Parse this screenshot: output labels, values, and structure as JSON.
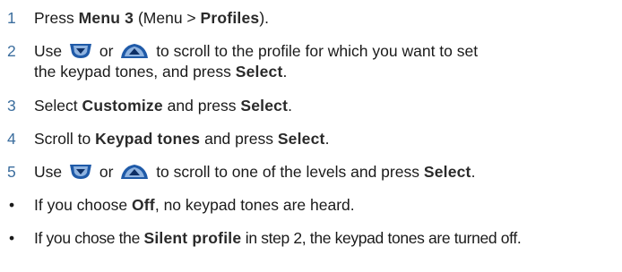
{
  "steps": [
    {
      "num": "1",
      "pre": "Press ",
      "bold1": "Menu 3",
      "mid": " (Menu > ",
      "bold2": "Profiles",
      "post": ")."
    },
    {
      "num": "2",
      "use": "Use",
      "or": "or",
      "line1_tail": "to scroll to the profile for which you want to set",
      "line2_pre": "the keypad tones, and press ",
      "line2_bold": "Select",
      "line2_post": "."
    },
    {
      "num": "3",
      "pre": "Select ",
      "bold1": "Customize",
      "mid": " and press ",
      "bold2": "Select",
      "post": "."
    },
    {
      "num": "4",
      "pre": "Scroll to ",
      "bold1": "Keypad tones",
      "mid": " and press ",
      "bold2": "Select",
      "post": "."
    },
    {
      "num": "5",
      "use": "Use",
      "or": "or",
      "tail": "to scroll to one of the levels and press ",
      "bold": "Select",
      "post": "."
    }
  ],
  "bullets": [
    {
      "marker": "•",
      "pre": "If you choose ",
      "bold": "Off",
      "post": ", no keypad tones are heard."
    },
    {
      "marker": "•",
      "pre": "If you chose the ",
      "bold": "Silent profile",
      "post": " in step 2, the keypad tones are turned off."
    }
  ],
  "icons": {
    "scroll_down": "scroll-down-key-icon",
    "scroll_up": "scroll-up-key-icon"
  },
  "colors": {
    "step_number": "#3c6e9e",
    "key_fill": "#1f5aa8",
    "text": "#1a1a1a"
  }
}
